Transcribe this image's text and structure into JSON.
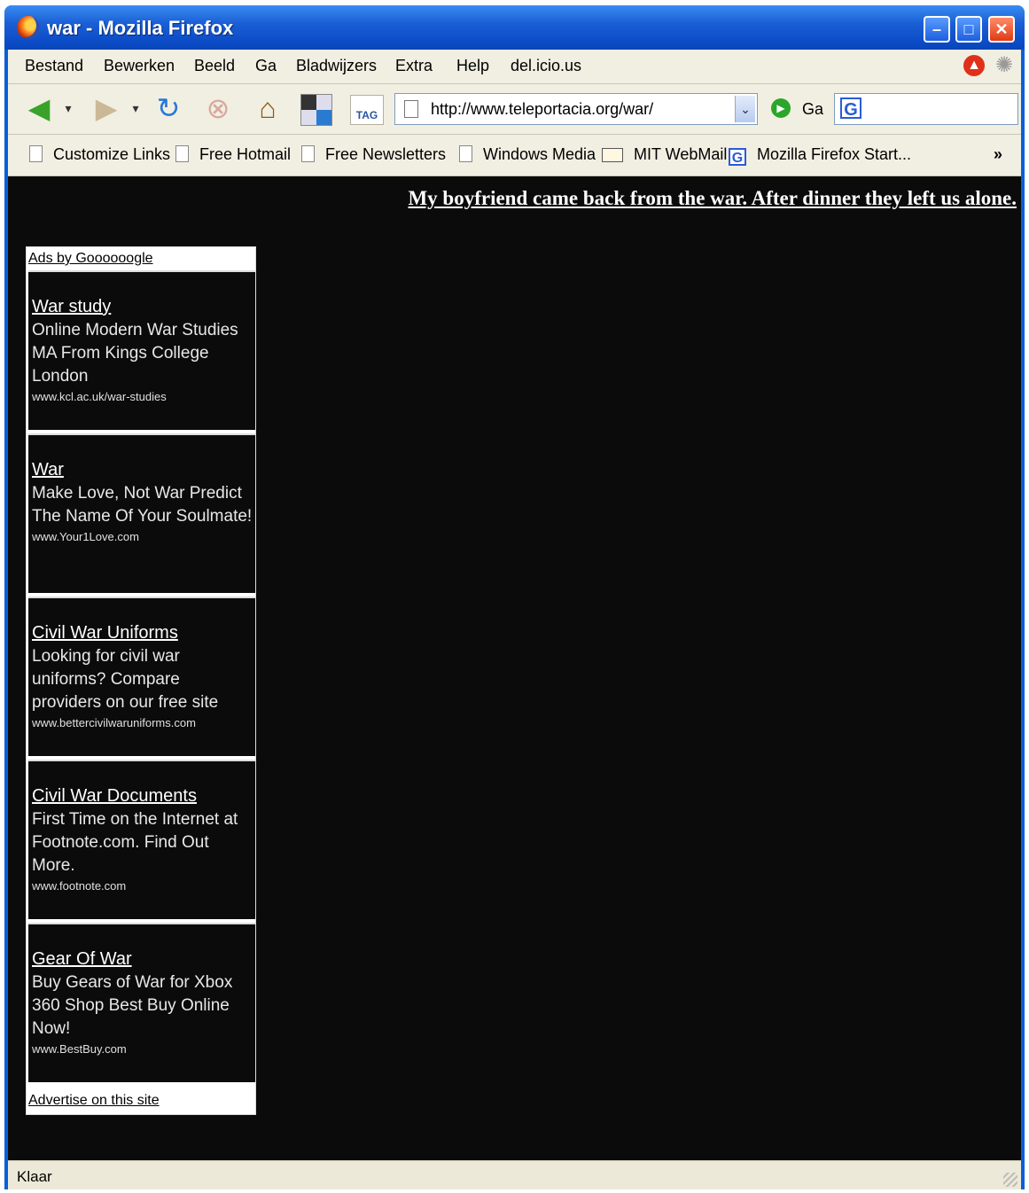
{
  "window": {
    "title": "war - Mozilla Firefox"
  },
  "menu": [
    "Bestand",
    "Bewerken",
    "Beeld",
    "Ga",
    "Bladwijzers",
    "Extra",
    "Help",
    "del.icio.us"
  ],
  "navbar": {
    "url": "http://www.teleportacia.org/war/",
    "go_label": "Ga",
    "tag_label": "TAG"
  },
  "links": [
    "Customize Links",
    "Free Hotmail",
    "Free Newsletters",
    "Windows Media",
    "MIT WebMail",
    "Mozilla Firefox Start...",
    "»"
  ],
  "page": {
    "headline": "My boyfriend came back from the war. After dinner they left us alone.",
    "ads_by": "Ads by Goooooogle",
    "advertise": "Advertise on this site",
    "ads": [
      {
        "title": "War study",
        "body": "Online Modern War Studies MA From Kings College London",
        "url": "www.kcl.ac.uk/war-studies"
      },
      {
        "title": "War",
        "body": "Make Love, Not War Predict The Name Of Your Soulmate!",
        "url": "www.Your1Love.com"
      },
      {
        "title": "Civil War Uniforms",
        "body": "Looking for civil war uniforms? Compare providers on our free site",
        "url": "www.bettercivilwaruniforms.com"
      },
      {
        "title": "Civil War Documents",
        "body": "First Time on the Internet at Footnote.com. Find Out More.",
        "url": "www.footnote.com"
      },
      {
        "title": "Gear Of War",
        "body": "Buy Gears of War for Xbox 360 Shop Best Buy Online Now!",
        "url": "www.BestBuy.com"
      }
    ]
  },
  "status": {
    "text": "Klaar"
  }
}
